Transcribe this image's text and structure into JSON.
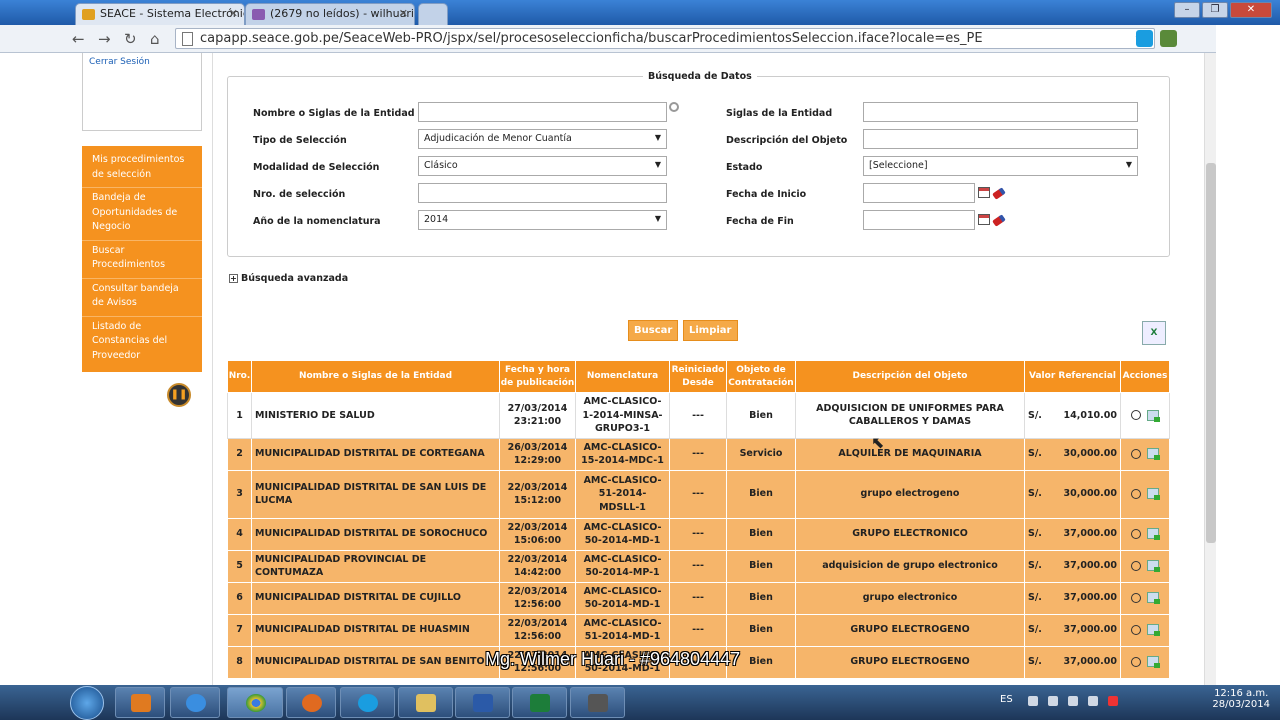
{
  "browser": {
    "tabs": [
      {
        "title": "SEACE - Sistema Electrónic",
        "fav_color": "#e0a020"
      },
      {
        "title": "(2679 no leídos) - wilhuari",
        "fav_color": "#8a5bb0"
      }
    ],
    "url": "capapp.seace.gob.pe/SeaceWeb-PRO/jspx/sel/procesoseleccionficha/buscarProcedimientosSeleccion.iface?locale=es_PE"
  },
  "sidebar": {
    "logout": "Cerrar Sesión",
    "menu": [
      "Mis procedimientos de selección",
      "Bandeja de Oportunidades de Negocio",
      "Buscar Procedimientos",
      "Consultar bandeja de Avisos",
      "Listado de Constancias del Proveedor"
    ]
  },
  "search": {
    "legend": "Búsqueda de Datos",
    "labels": {
      "entidad": "Nombre o Siglas de la Entidad",
      "tipo": "Tipo de Selección",
      "modalidad": "Modalidad de Selección",
      "nro": "Nro. de selección",
      "anio": "Año de la nomenclatura",
      "siglas": "Siglas de la Entidad",
      "descripcion": "Descripción del Objeto",
      "estado": "Estado",
      "fecha_inicio": "Fecha de Inicio",
      "fecha_fin": "Fecha de Fin"
    },
    "values": {
      "tipo": "Adjudicación de Menor Cuantía",
      "modalidad": "Clásico",
      "anio": "2014",
      "estado": "[Seleccione]"
    },
    "advanced": "Búsqueda avanzada",
    "buscar": "Buscar",
    "limpiar": "Limpiar"
  },
  "table": {
    "headers": [
      "Nro.",
      "Nombre o Siglas de la Entidad",
      "Fecha y hora de publicación",
      "Nomenclatura",
      "Reiniciado Desde",
      "Objeto de Contratación",
      "Descripción del Objeto",
      "Valor Referencial",
      "Acciones"
    ],
    "rows": [
      {
        "nro": "1",
        "entidad": "MINISTERIO DE SALUD",
        "fecha": "27/03/2014 23:21:00",
        "nom": "AMC-CLASICO-1-2014-MINSA-GRUPO3-1",
        "reini": "---",
        "objeto": "Bien",
        "desc": "ADQUISICION DE UNIFORMES PARA CABALLEROS Y DAMAS",
        "moneda": "S/.",
        "valor": "14,010.00"
      },
      {
        "nro": "2",
        "entidad": "MUNICIPALIDAD DISTRITAL DE CORTEGANA",
        "fecha": "26/03/2014 12:29:00",
        "nom": "AMC-CLASICO-15-2014-MDC-1",
        "reini": "---",
        "objeto": "Servicio",
        "desc": "ALQUILER DE MAQUINARIA",
        "moneda": "S/.",
        "valor": "30,000.00"
      },
      {
        "nro": "3",
        "entidad": "MUNICIPALIDAD DISTRITAL DE SAN LUIS DE LUCMA",
        "fecha": "22/03/2014 15:12:00",
        "nom": "AMC-CLASICO-51-2014-MDSLL-1",
        "reini": "---",
        "objeto": "Bien",
        "desc": "grupo electrogeno",
        "moneda": "S/.",
        "valor": "30,000.00"
      },
      {
        "nro": "4",
        "entidad": "MUNICIPALIDAD DISTRITAL DE SOROCHUCO",
        "fecha": "22/03/2014 15:06:00",
        "nom": "AMC-CLASICO-50-2014-MD-1",
        "reini": "---",
        "objeto": "Bien",
        "desc": "GRUPO ELECTRONICO",
        "moneda": "S/.",
        "valor": "37,000.00"
      },
      {
        "nro": "5",
        "entidad": "MUNICIPALIDAD PROVINCIAL DE CONTUMAZA",
        "fecha": "22/03/2014 14:42:00",
        "nom": "AMC-CLASICO-50-2014-MP-1",
        "reini": "---",
        "objeto": "Bien",
        "desc": "adquisicion de grupo electronico",
        "moneda": "S/.",
        "valor": "37,000.00"
      },
      {
        "nro": "6",
        "entidad": "MUNICIPALIDAD DISTRITAL DE CUJILLO",
        "fecha": "22/03/2014 12:56:00",
        "nom": "AMC-CLASICO-50-2014-MD-1",
        "reini": "---",
        "objeto": "Bien",
        "desc": "grupo electronico",
        "moneda": "S/.",
        "valor": "37,000.00"
      },
      {
        "nro": "7",
        "entidad": "MUNICIPALIDAD DISTRITAL DE HUASMIN",
        "fecha": "22/03/2014 12:56:00",
        "nom": "AMC-CLASICO-51-2014-MD-1",
        "reini": "---",
        "objeto": "Bien",
        "desc": "GRUPO ELECTROGENO",
        "moneda": "S/.",
        "valor": "37,000.00"
      },
      {
        "nro": "8",
        "entidad": "MUNICIPALIDAD DISTRITAL DE SAN BENITO",
        "fecha": "22/03/2014 12:56:00",
        "nom": "AMC-CLASICO-50-2014-MD-1",
        "reini": "---",
        "objeto": "Bien",
        "desc": "GRUPO ELECTROGENO",
        "moneda": "S/.",
        "valor": "37,000.00"
      }
    ]
  },
  "watermark": "Mg. Wilmer Huari - #964804447",
  "taskbar": {
    "lang": "ES",
    "time": "12:16 a.m.",
    "date": "28/03/2014"
  },
  "colors": {
    "accent": "#f5921f",
    "row_alt": "#f6b56a"
  }
}
